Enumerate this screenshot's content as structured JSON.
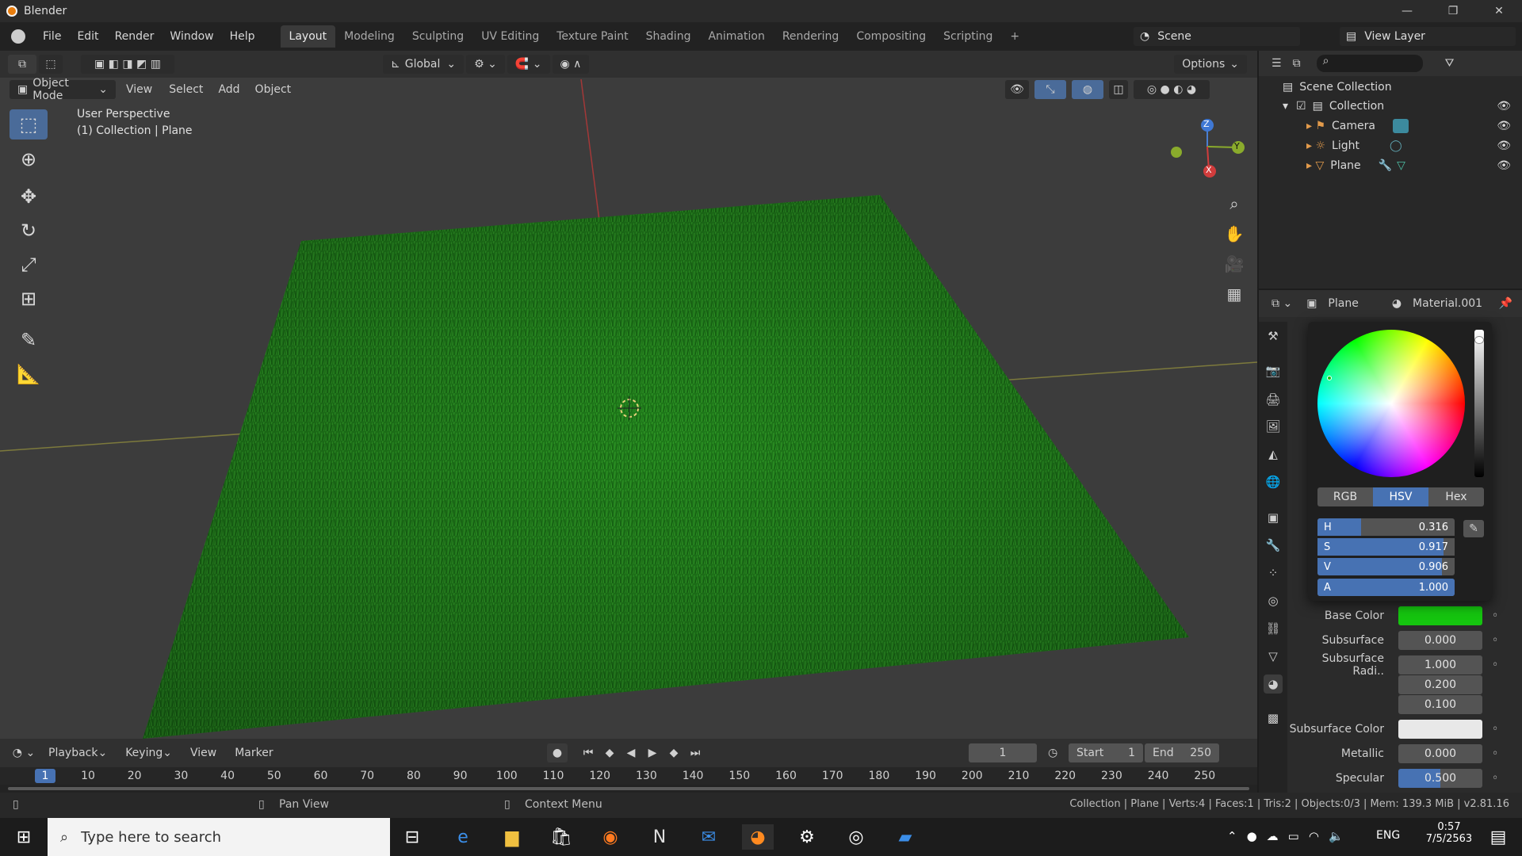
{
  "app": {
    "title": "Blender"
  },
  "window_controls": {
    "minimize": "—",
    "maximize": "❐",
    "close": "✕"
  },
  "menu": [
    "File",
    "Edit",
    "Render",
    "Window",
    "Help"
  ],
  "workspaces": [
    "Layout",
    "Modeling",
    "Sculpting",
    "UV Editing",
    "Texture Paint",
    "Shading",
    "Animation",
    "Rendering",
    "Compositing",
    "Scripting"
  ],
  "workspace_add": "+",
  "scene": {
    "name": "Scene",
    "view_layer": "View Layer"
  },
  "viewport": {
    "mode": "Object Mode",
    "menus": [
      "View",
      "Select",
      "Add",
      "Object"
    ],
    "transform_orientation": "Global",
    "options": "Options",
    "overlay_title": "User Perspective",
    "overlay_subtitle": "(1) Collection | Plane",
    "gizmo": {
      "z": "Z",
      "y": "Y",
      "x": "X"
    },
    "grass_color": "#1f7a1a"
  },
  "outliner": {
    "root": "Scene Collection",
    "collection": "Collection",
    "items": [
      "Camera",
      "Light",
      "Plane"
    ]
  },
  "properties": {
    "object": "Plane",
    "material": "Material.001",
    "color_picker": {
      "modes": [
        "RGB",
        "HSV",
        "Hex"
      ],
      "active_mode": "HSV",
      "fields": [
        {
          "key": "H",
          "value": "0.316",
          "fraction": 0.316
        },
        {
          "key": "S",
          "value": "0.917",
          "fraction": 0.917
        },
        {
          "key": "V",
          "value": "0.906",
          "fraction": 0.906
        },
        {
          "key": "A",
          "value": "1.000",
          "fraction": 1.0
        }
      ]
    },
    "rows": [
      {
        "label": "Base Color",
        "value": "",
        "swatch": "#15c40f"
      },
      {
        "label": "Subsurface",
        "value": "0.000"
      },
      {
        "label": "Subsurface Radi..",
        "value": "1.000"
      },
      {
        "label": "",
        "value": "0.200"
      },
      {
        "label": "",
        "value": "0.100"
      },
      {
        "label": "Subsurface Color",
        "value": "",
        "swatch": "#e8e8e8"
      },
      {
        "label": "Metallic",
        "value": "0.000"
      },
      {
        "label": "Specular",
        "value": "0.500",
        "fraction": 0.5
      }
    ]
  },
  "timeline": {
    "menus": [
      "Playback",
      "Keying",
      "View",
      "Marker"
    ],
    "current_frame": "1",
    "start_label": "Start",
    "start": "1",
    "end_label": "End",
    "end": "250",
    "ruler": [
      "1",
      "10",
      "20",
      "30",
      "40",
      "50",
      "60",
      "70",
      "80",
      "90",
      "100",
      "110",
      "120",
      "130",
      "140",
      "150",
      "160",
      "170",
      "180",
      "190",
      "200",
      "210",
      "220",
      "230",
      "240",
      "250"
    ]
  },
  "status": {
    "pan": "Pan View",
    "context": "Context Menu",
    "info": "Collection | Plane | Verts:4 | Faces:1 | Tris:2 | Objects:0/3 | Mem: 139.3 MiB | v2.81.16"
  },
  "taskbar": {
    "search_placeholder": "Type here to search",
    "lang": "ENG",
    "time": "0:57",
    "date": "7/5/2563"
  }
}
